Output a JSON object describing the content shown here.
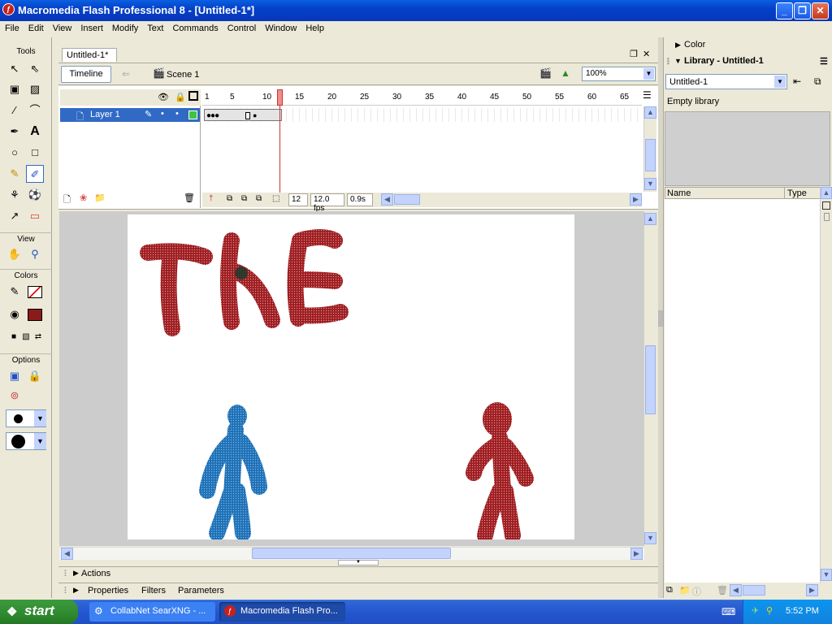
{
  "window": {
    "title": "Macromedia Flash Professional 8 - [Untitled-1*]",
    "minimize": "_",
    "restore": "❐",
    "close": "✕"
  },
  "menu": [
    "File",
    "Edit",
    "View",
    "Insert",
    "Modify",
    "Text",
    "Commands",
    "Control",
    "Window",
    "Help"
  ],
  "tools": {
    "title": "Tools",
    "view_label": "View",
    "colors_label": "Colors",
    "options_label": "Options",
    "stroke_color": "#000000",
    "fill_color": "#8b1a1a"
  },
  "document": {
    "tab_label": "Untitled-1*",
    "timeline_button": "Timeline",
    "scene_label": "Scene 1",
    "zoom_value": "100%"
  },
  "timeline": {
    "layer_name": "Layer 1",
    "ruler_ticks": [
      "1",
      "5",
      "10",
      "15",
      "20",
      "25",
      "30",
      "35",
      "40",
      "45",
      "50",
      "55",
      "60",
      "65"
    ],
    "current_frame": "12",
    "frame_rate": "12.0 fps",
    "elapsed": "0.9s"
  },
  "stage": {
    "text_drawing": "THE",
    "text_color": "#a01e22",
    "figure_left_color": "#1f72b8",
    "figure_right_color": "#a01e22"
  },
  "bottom_panels": {
    "actions": "Actions",
    "properties": "Properties",
    "filters": "Filters",
    "parameters": "Parameters"
  },
  "right_panel": {
    "color_header": "Color",
    "library_header": "Library - Untitled-1",
    "library_select": "Untitled-1",
    "empty_library": "Empty library",
    "col_name": "Name",
    "col_type": "Type"
  },
  "taskbar": {
    "start": "start",
    "tasks": [
      "CollabNet SearXNG - ...",
      "Macromedia Flash Pro..."
    ],
    "clock": "5:52 PM"
  }
}
